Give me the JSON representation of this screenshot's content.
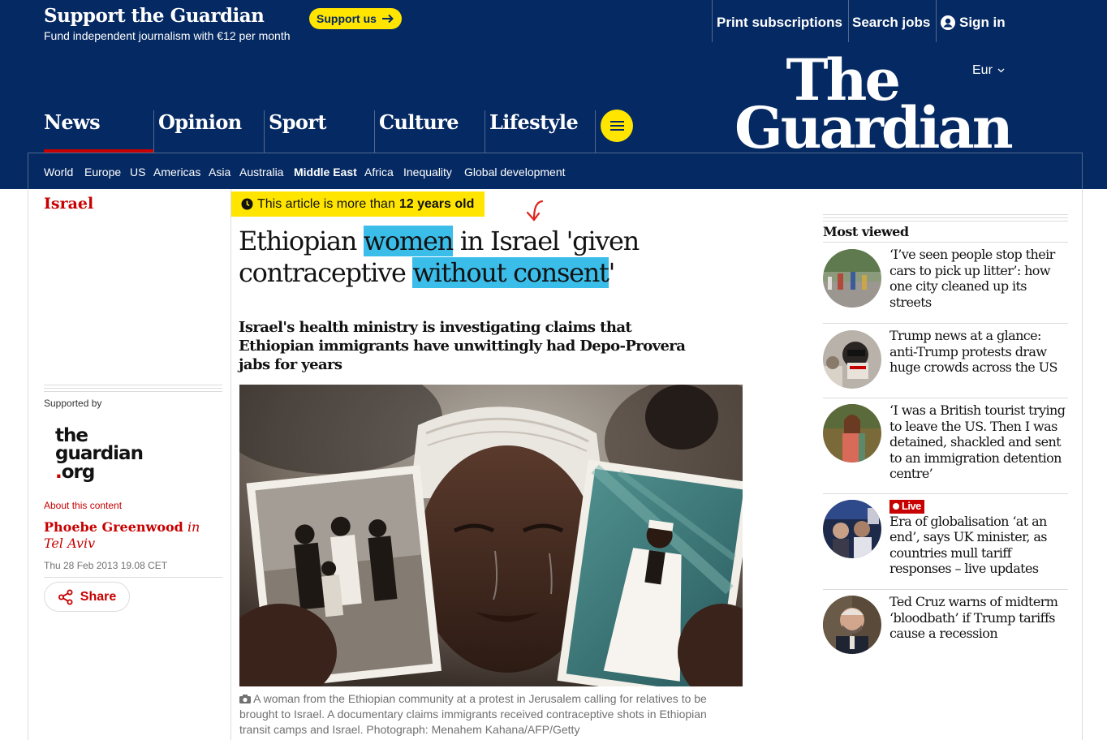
{
  "support_bar": {
    "title": "Support the Guardian",
    "subtitle": "Fund independent journalism with €12 per month",
    "support_button": "Support us",
    "links": [
      "Print subscriptions",
      "Search jobs",
      "Sign in"
    ]
  },
  "header": {
    "edition": "Eur",
    "logo_line1": "The",
    "logo_line2": "Guardian",
    "pillars": [
      "News",
      "Opinion",
      "Sport",
      "Culture",
      "Lifestyle"
    ],
    "subnav": [
      "World",
      "Europe",
      "US",
      "Americas",
      "Asia",
      "Australia",
      "Middle East",
      "Africa",
      "Inequality",
      "Global development"
    ],
    "active_subnav": "Middle East"
  },
  "left": {
    "section": "Israel",
    "supported_by": "Supported by",
    "org_logo": {
      "line1": "the",
      "line2": "guardian",
      "dot": ".",
      "line3": "org"
    },
    "about": "About this content",
    "author": "Phoebe Greenwood",
    "location": "in Tel Aviv",
    "date": "Thu 28 Feb 2013 19.08 CET",
    "share": "Share"
  },
  "article": {
    "age_prefix": "This article is more than",
    "age_value": "12 years old",
    "headline": {
      "p1": "Ethiopian ",
      "h1": "women",
      "p2": " in Israel 'given contraceptive ",
      "h2": "without consent",
      "p3": "'"
    },
    "standfirst": "Israel's health ministry is investigating claims that Ethiopian immigrants have unwittingly had Depo-Provera jabs for years",
    "caption": "A woman from the Ethiopian community at a protest in Jerusalem calling for relatives to be brought to Israel. A documentary claims immigrants received contraceptive shots in Ethiopian transit camps and Israel. Photograph: Menahem Kahana/AFP/Getty"
  },
  "most_viewed": {
    "title": "Most viewed",
    "items": [
      {
        "text": "‘I’ve seen people stop their cars to pick up litter’: how one city cleaned up its streets"
      },
      {
        "text": "Trump news at a glance: anti-Trump protests draw huge crowds across the US"
      },
      {
        "text": "‘I was a British tourist trying to leave the US. Then I was detained, shackled and sent to an immigration detention centre’"
      },
      {
        "live": "Live",
        "text": "Era of globalisation ‘at an end’, says UK minister, as countries mull tariff responses – live updates"
      },
      {
        "text": "Ted Cruz warns of midterm ‘bloodbath’ if Trump tariffs cause a recession"
      }
    ]
  },
  "colors": {
    "brand_blue": "#052962",
    "accent_yellow": "#ffe500",
    "news_red": "#c70000",
    "highlight": "#3bbdea"
  },
  "icons": [
    "arrow-right-icon",
    "user-icon",
    "chevron-down-icon",
    "menu-icon",
    "clock-icon",
    "share-icon",
    "camera-icon",
    "live-dot-icon"
  ]
}
